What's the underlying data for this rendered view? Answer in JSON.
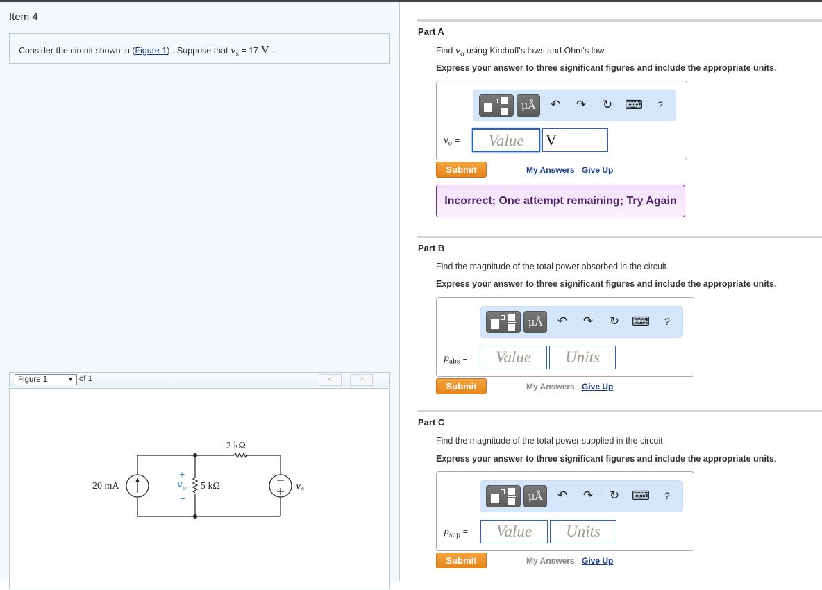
{
  "item": {
    "title": "Item 4",
    "intro_prefix": "Consider the circuit shown in (",
    "intro_link": "Figure 1",
    "intro_mid": ") . Suppose that ",
    "intro_var": "v",
    "intro_var_sub": "s",
    "intro_eq": " = 17 ",
    "intro_unit": "V",
    "intro_end": " ."
  },
  "figure": {
    "selector_value": "Figure 1",
    "of_label": "of 1",
    "prev_label": "<",
    "next_label": ">",
    "circuit": {
      "current_source": "20 mA",
      "resistor_top": "2 kΩ",
      "resistor_mid": "5 kΩ",
      "vo_label": "v",
      "vo_sub": "o",
      "vs_label": "v",
      "vs_sub": "s",
      "plus": "+",
      "minus": "−",
      "accent_color": "#2b9bd1"
    }
  },
  "toolbar": {
    "templates_icon": "templates-icon",
    "units_label": "μÅ",
    "undo_icon": "↶",
    "redo_icon": "↷",
    "reset_icon": "↻",
    "keyboard_icon": "⌨",
    "help_label": "?"
  },
  "parts": [
    {
      "title": "Part A",
      "question_prefix": "Find ",
      "question_var": "v",
      "question_sub": "o",
      "question_suffix": " using Kirchoff's laws and Ohm's law.",
      "instruction": "Express your answer to three significant figures and include the appropriate units.",
      "var_label": "v",
      "var_sub": "o",
      "equals": "=",
      "value_placeholder": "Value",
      "unit_value": "V",
      "submit": "Submit",
      "my_answers": "My Answers",
      "give_up": "Give Up",
      "feedback": "Incorrect; One attempt remaining; Try Again"
    },
    {
      "title": "Part B",
      "question": "Find the magnitude of the total power absorbed in the circuit.",
      "instruction": "Express your answer to three significant figures and include the appropriate units.",
      "var_label": "p",
      "var_sub": "abs",
      "equals": "=",
      "value_placeholder": "Value",
      "units_placeholder": "Units",
      "submit": "Submit",
      "my_answers": "My Answers",
      "give_up": "Give Up"
    },
    {
      "title": "Part C",
      "question": "Find the magnitude of the total power supplied in the circuit.",
      "instruction": "Express your answer to three significant figures and include the appropriate units.",
      "var_label": "p",
      "var_sub": "sup",
      "equals": "=",
      "value_placeholder": "Value",
      "units_placeholder": "Units",
      "submit": "Submit",
      "my_answers": "My Answers",
      "give_up": "Give Up"
    }
  ],
  "colors": {
    "submit_orange": "#e98a22",
    "link_blue": "#1a3d8f",
    "input_border": "#2a62c0",
    "toolbar_bg": "#d3e6fb",
    "feedback_text": "#4b2266"
  }
}
